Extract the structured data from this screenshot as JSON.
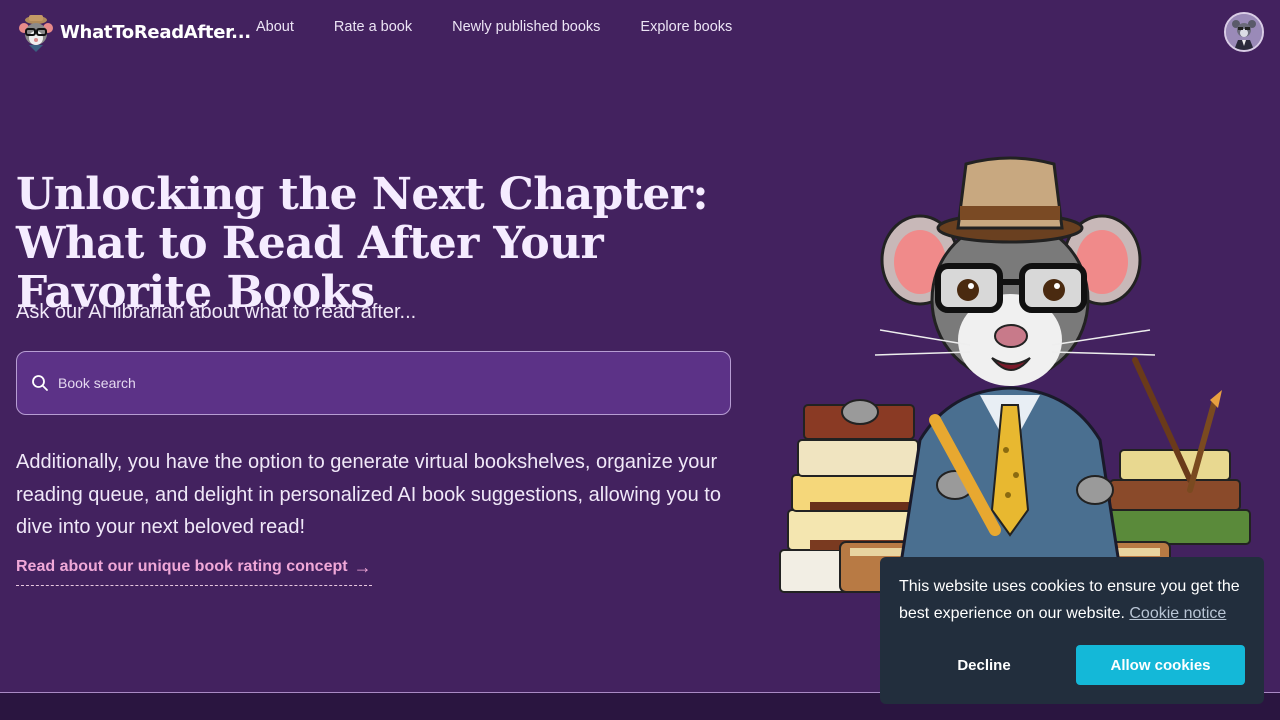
{
  "nav": {
    "brand": "WhatToReadAfter...",
    "links": [
      "About",
      "Rate a book",
      "Newly published books",
      "Explore books"
    ]
  },
  "hero": {
    "title": "Unlocking the Next Chapter: What to Read After Your Favorite Books",
    "subtitle": "Ask our AI librarian about what to read after...",
    "search_placeholder": "Book search",
    "description": "Additionally, you have the option to generate virtual bookshelves, organize your reading queue, and delight in personalized AI book suggestions, allowing you to dive into your next beloved read!",
    "concept_link": "Read about our unique book rating concept",
    "arrow": "→"
  },
  "cookie": {
    "text": "This website uses cookies to ensure you get the best experience on our website.",
    "notice_link": "Cookie notice",
    "decline": "Decline",
    "allow": "Allow cookies"
  },
  "colors": {
    "background": "#43225f",
    "search_bg": "#5c3287",
    "link_pink": "#f0a8d8",
    "cookie_bg": "#222e3d",
    "allow_btn": "#14b8d8"
  }
}
